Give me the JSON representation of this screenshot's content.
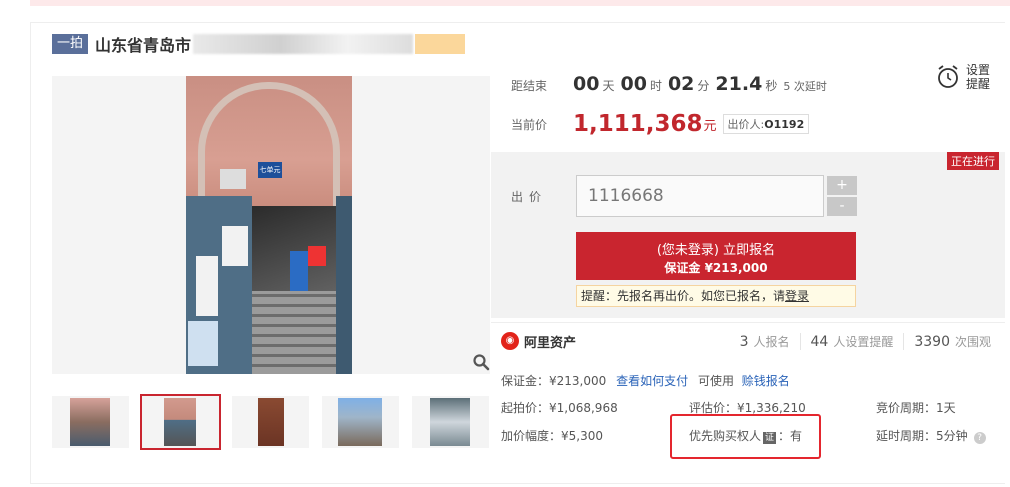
{
  "header": {
    "tag": "一拍",
    "title": "山东省青岛市"
  },
  "countdown": {
    "label": "距结束",
    "days": "00",
    "days_unit": "天",
    "hours": "00",
    "hours_unit": "时",
    "minutes": "02",
    "minutes_unit": "分",
    "seconds": "21.4",
    "seconds_unit": "秒",
    "delay_text": "5 次延时"
  },
  "reminder": {
    "label": "设置提醒"
  },
  "price": {
    "label": "当前价",
    "value": "1,111,368",
    "unit": "元",
    "bidder_label": "出价人:",
    "bidder_id": "O1192"
  },
  "bid": {
    "status": "正在进行",
    "label": "出价",
    "input_value": "1116668",
    "plus": "+",
    "minus": "-",
    "register_line1": "(您未登录) 立即报名",
    "register_line2": "保证金 ¥213,000",
    "hint_text": "提醒：先报名再出价。如您已报名，请",
    "hint_link": "登录"
  },
  "platform": {
    "name": "阿里资产",
    "stats": [
      {
        "num": "3",
        "label": "人报名"
      },
      {
        "num": "44",
        "label": "人设置提醒"
      },
      {
        "num": "3390",
        "label": "次围观"
      }
    ]
  },
  "details": {
    "deposit": "保证金：¥213,000",
    "how_to_pay": "查看如何支付",
    "usable": "可使用",
    "credit_signup": "赊钱报名",
    "start_price": "起拍价：¥1,068,968",
    "appraisal": "评估价：¥1,336,210",
    "cycle": "竞价周期：1天",
    "increment": "加价幅度：¥5,300",
    "priority_label": "优先购买权人",
    "priority_icon": "证",
    "priority_value": "：有",
    "delay_cycle": "延时周期：5分钟",
    "help_icon": "?"
  }
}
